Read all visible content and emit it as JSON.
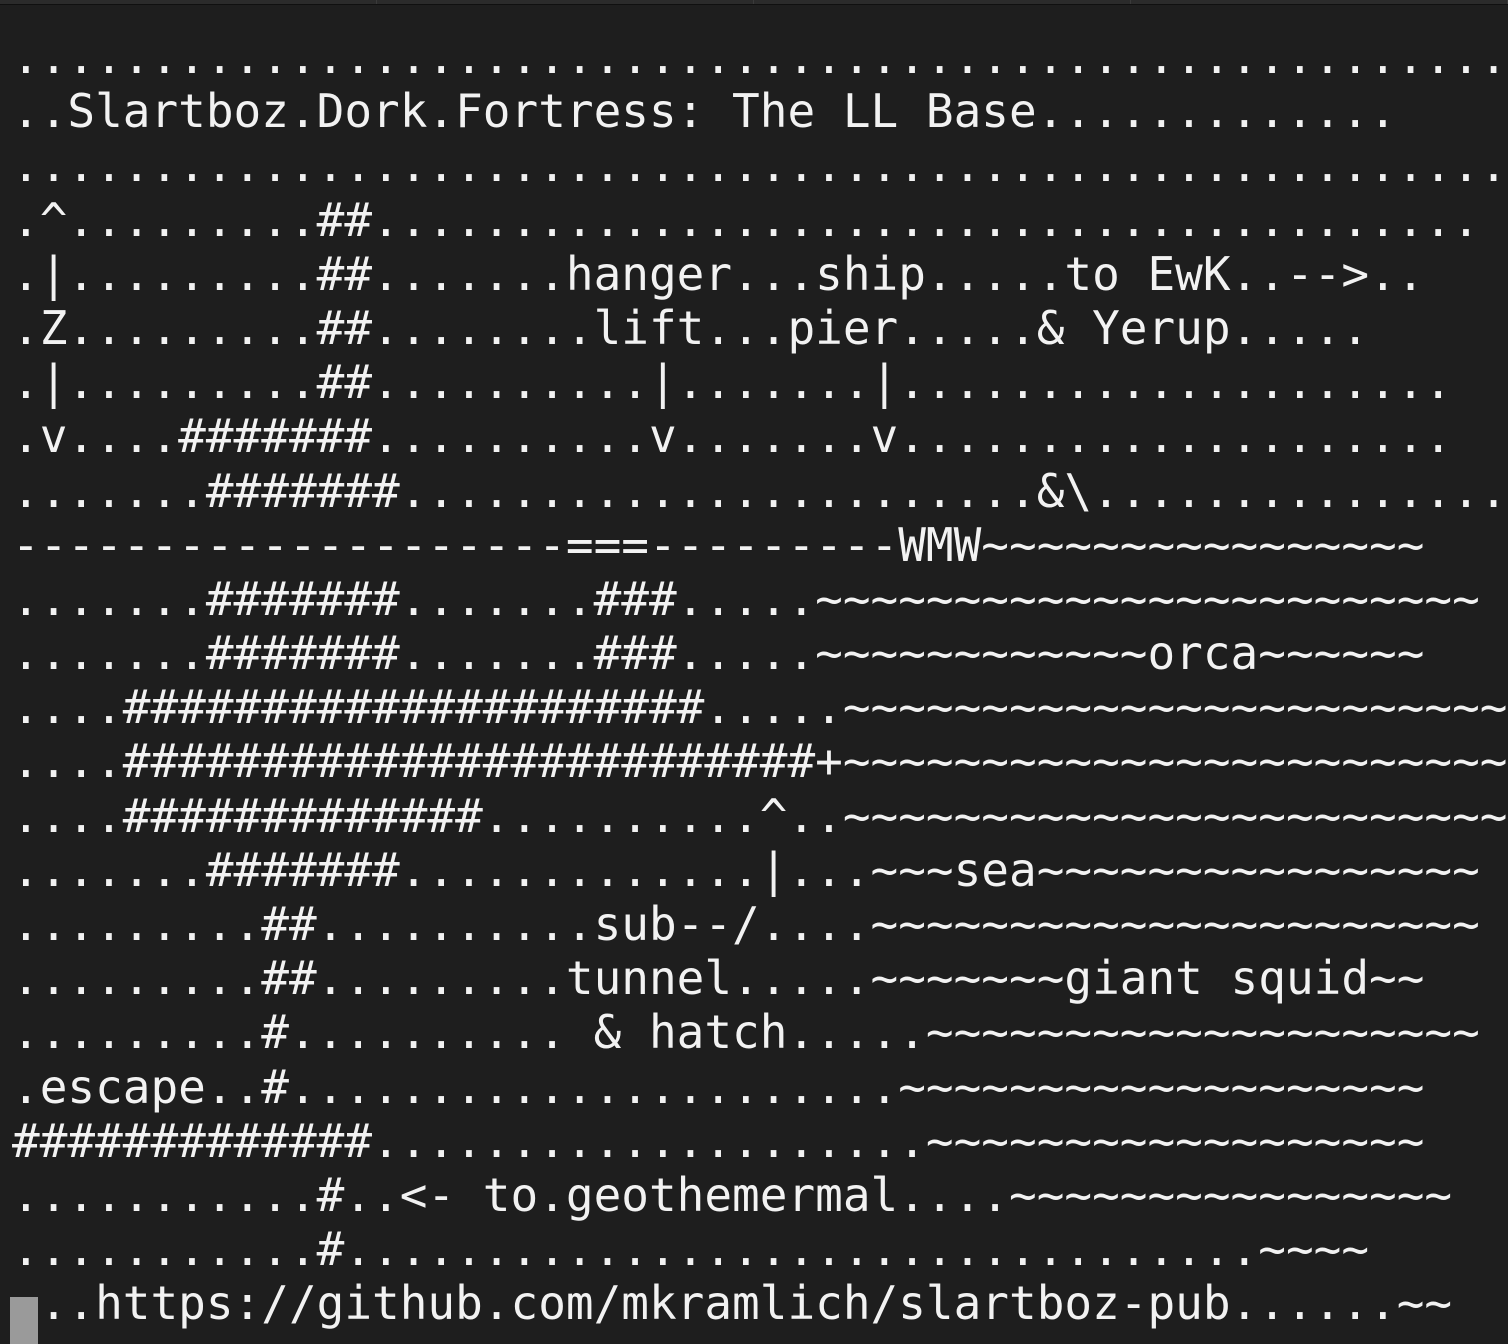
{
  "terminal": {
    "lines": [
      "......................................................",
      "..Slartboz.Dork.Fortress: The LL Base.............",
      "......................................................",
      ".^.........##........................................",
      ".|.........##.......hanger...ship.....to EwK..-->..",
      ".Z.........##........lift...pier.....& Yerup.....",
      ".|.........##..........|.......|....................",
      ".v....#######..........v.......v....................",
      ".......#######.......................&\\................",
      "--------------------===---------WMW~~~~~~~~~~~~~~~~",
      ".......#######.......###.....~~~~~~~~~~~~~~~~~~~~~~~~",
      ".......#######.......###.....~~~~~~~~~~~~orca~~~~~~",
      "....#####################.....~~~~~~~~~~~~~~~~~~~~~~~~",
      "....#########################+~~~~~~~~~~~~~~~~~~~~~~~~",
      "....#############..........^..~~~~~~~~~~~~~~~~~~~~~~~~",
      ".......#######.............|...~~~sea~~~~~~~~~~~~~~~~",
      ".........##..........sub--/....~~~~~~~~~~~~~~~~~~~~~~",
      ".........##.........tunnel.....~~~~~~~giant squid~~",
      ".........#.......... & hatch.....~~~~~~~~~~~~~~~~~~~~",
      ".escape..#......................~~~~~~~~~~~~~~~~~~~",
      "#############....................~~~~~~~~~~~~~~~~~~",
      "...........#..<- to.geothemermal....~~~~~~~~~~~~~~~~",
      "...........#.................................~~~~",
      "...https://github.com/mkramlich/slartboz-pub......~~"
    ]
  }
}
